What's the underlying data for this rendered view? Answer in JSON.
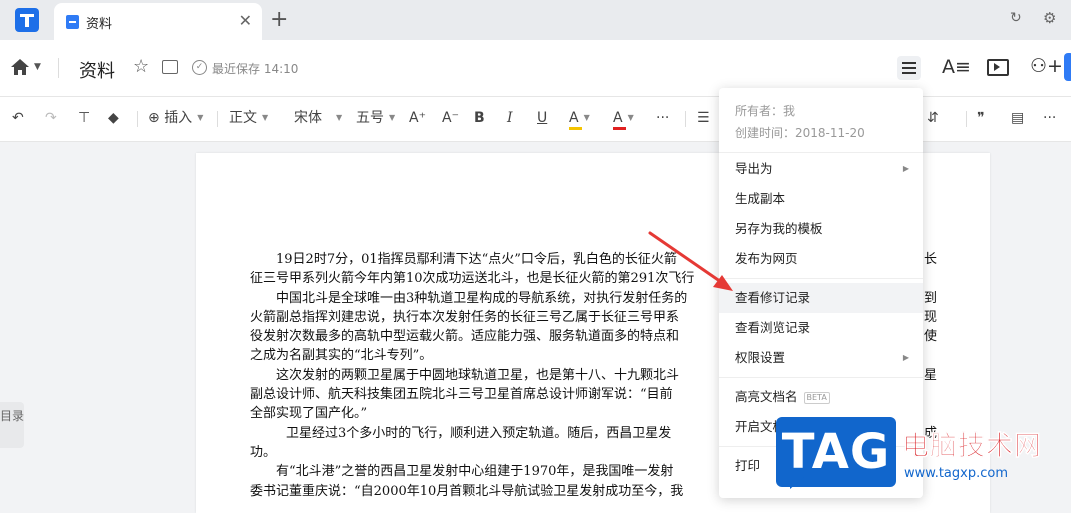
{
  "tabbar": {
    "tab_title": "资料",
    "close_glyph": "✕",
    "new_tab_glyph": "+"
  },
  "header": {
    "doc_title": "资料",
    "save_status": "最近保存 14:10",
    "star_glyph": "☆",
    "font_glyph": "A≡",
    "adduser_glyph": "⚇+"
  },
  "toolbar": {
    "undo": "↶",
    "redo": "↷",
    "format_painter": "⊤",
    "eraser": "◆",
    "insert": "插入",
    "insert_icon": "⊕",
    "style": "正文",
    "font": "宋体",
    "size": "五号",
    "grow": "A⁺",
    "shrink": "A⁻",
    "bold": "B",
    "italic": "I",
    "underline": "U",
    "highlight": "A",
    "font_color": "A",
    "more": "···",
    "list": "☰",
    "line_spacing": "⇵",
    "quote": "❞",
    "layout": "▤",
    "more_right": "···"
  },
  "document": {
    "paragraphs": [
      "19日2时7分，01指挥员鄢利清下达“点火”口令后，乳白色的长征火箭",
      "征三号甲系列火箭今年内第10次成功运送北斗，也是长征火箭的第291次飞行",
      "中国北斗是全球唯一由3种轨道卫星构成的导航系统，对执行发射任务的",
      "火箭副总指挥刘建忠说，执行本次发射任务的长征三号乙属于长征三号甲系",
      "役发射次数最多的高轨中型运载火箭。适应能力强、服务轨道面多的特点和",
      "之成为名副其实的“北斗专列”。",
      "这次发射的两颗卫星属于中圆地球轨道卫星，也是第十八、十九颗北斗",
      "副总设计师、航天科技集团五院北斗三号卫星首席总设计师谢军说：“目前",
      "全部实现了国产化。”",
      "卫星经过3个多小时的飞行，顺利进入预定轨道。随后，西昌卫星发",
      "功。",
      "有“北斗港”之誉的西昌卫星发射中心组建于1970年，是我国唯一发射",
      "委书记董重庆说：“自2000年10月首颗北斗导航试验卫星发射成功至今，我"
    ],
    "right_edge_chars": [
      "长",
      "",
      "到",
      "现",
      "使",
      "",
      "星",
      "",
      "",
      "成"
    ],
    "outline_label": "目录"
  },
  "menu": {
    "owner": "所有者：我",
    "created": "创建时间：2018-11-20",
    "items": [
      {
        "label": "导出为",
        "submenu": true
      },
      {
        "label": "生成副本"
      },
      {
        "label": "另存为我的模板"
      },
      {
        "label": "发布为网页"
      },
      {
        "label": "查看修订记录",
        "active": true
      },
      {
        "label": "查看浏览记录"
      },
      {
        "label": "权限设置",
        "submenu": true
      },
      {
        "label": "高亮文档名",
        "badge": "BETA"
      },
      {
        "label": "开启文档水印"
      },
      {
        "label": "打印"
      }
    ],
    "submenu_arrow": "▶"
  },
  "watermark": {
    "tag": "TAG",
    "title": "电脑技术网",
    "url": "www.tagxp.com"
  },
  "colors": {
    "accent": "#2f7bf5",
    "annotation": "#e53935",
    "highlight": "#f5c400",
    "font_color": "#e02020"
  }
}
